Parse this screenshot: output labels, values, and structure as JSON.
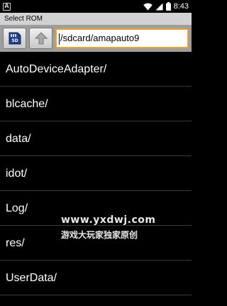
{
  "status_bar": {
    "notification_icon": "A",
    "time": "8:43",
    "icons": [
      "wifi-icon",
      "signal-icon",
      "battery-icon"
    ]
  },
  "title_bar": {
    "title": "Select ROM"
  },
  "toolbar": {
    "sd_button_icon": "sd-card-icon",
    "up_button_icon": "arrow-up-icon",
    "path_value": "/sdcard/amapauto9"
  },
  "files": [
    {
      "name": "AutoDeviceAdapter/"
    },
    {
      "name": "blcache/"
    },
    {
      "name": "data/"
    },
    {
      "name": "idot/"
    },
    {
      "name": "Log/"
    },
    {
      "name": "res/"
    },
    {
      "name": "UserData/"
    }
  ],
  "watermark": {
    "url": "www.yxdwj.com",
    "text": "游戏大玩家独家原创"
  },
  "colors": {
    "title_bar_bg": "#d2d2d2",
    "toolbar_bg": "#9e9e9e",
    "path_border": "#f0a030",
    "background": "#000000"
  }
}
